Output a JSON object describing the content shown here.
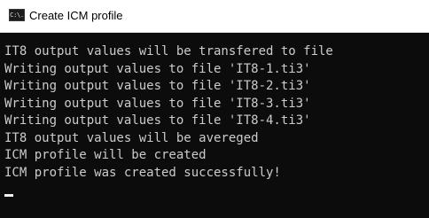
{
  "window": {
    "title": "Create ICM profile",
    "icon": "cmd-icon",
    "icon_text": "C:\\."
  },
  "console": {
    "lines": [
      "IT8 output values will be transfered to file",
      "Writing output values to file 'IT8-1.ti3'",
      "Writing output values to file 'IT8-2.ti3'",
      "Writing output values to file 'IT8-3.ti3'",
      "Writing output values to file 'IT8-4.ti3'",
      "IT8 output values will be avereged",
      "ICM profile will be created",
      "ICM profile was created successfully!"
    ],
    "text_color": "#cccccc",
    "background_color": "#0c0c0c"
  }
}
